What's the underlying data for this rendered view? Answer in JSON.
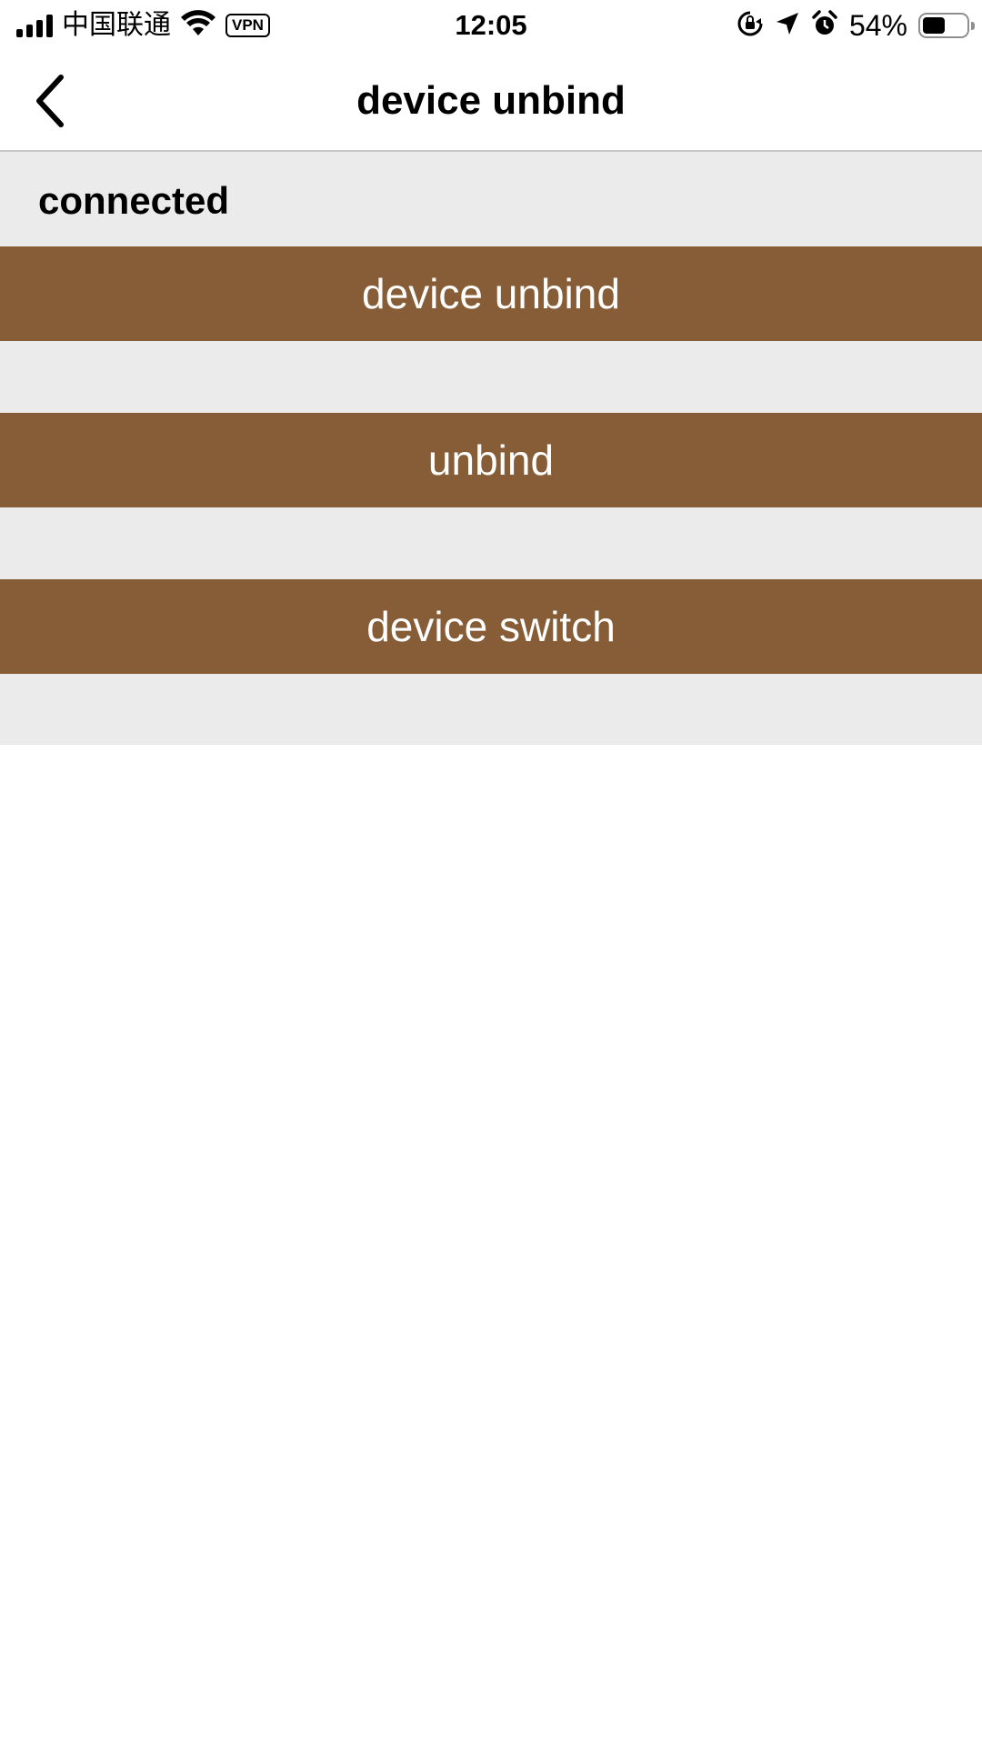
{
  "status_bar": {
    "carrier": "中国联通",
    "vpn": "VPN",
    "time": "12:05",
    "battery_percent": "54%",
    "battery_level": 0.54,
    "icons": [
      "signal-icon",
      "wifi-icon",
      "orientation-lock-icon",
      "location-icon",
      "alarm-icon",
      "battery-icon"
    ]
  },
  "nav": {
    "title": "device unbind",
    "back_icon": "chevron-left-icon"
  },
  "main": {
    "status_text": "connected",
    "buttons": [
      {
        "label": "device unbind"
      },
      {
        "label": "unbind"
      },
      {
        "label": "device switch"
      }
    ]
  },
  "colors": {
    "button_bg": "#865d36",
    "panel_bg": "#ebebeb",
    "page_bg": "#ffffff"
  }
}
